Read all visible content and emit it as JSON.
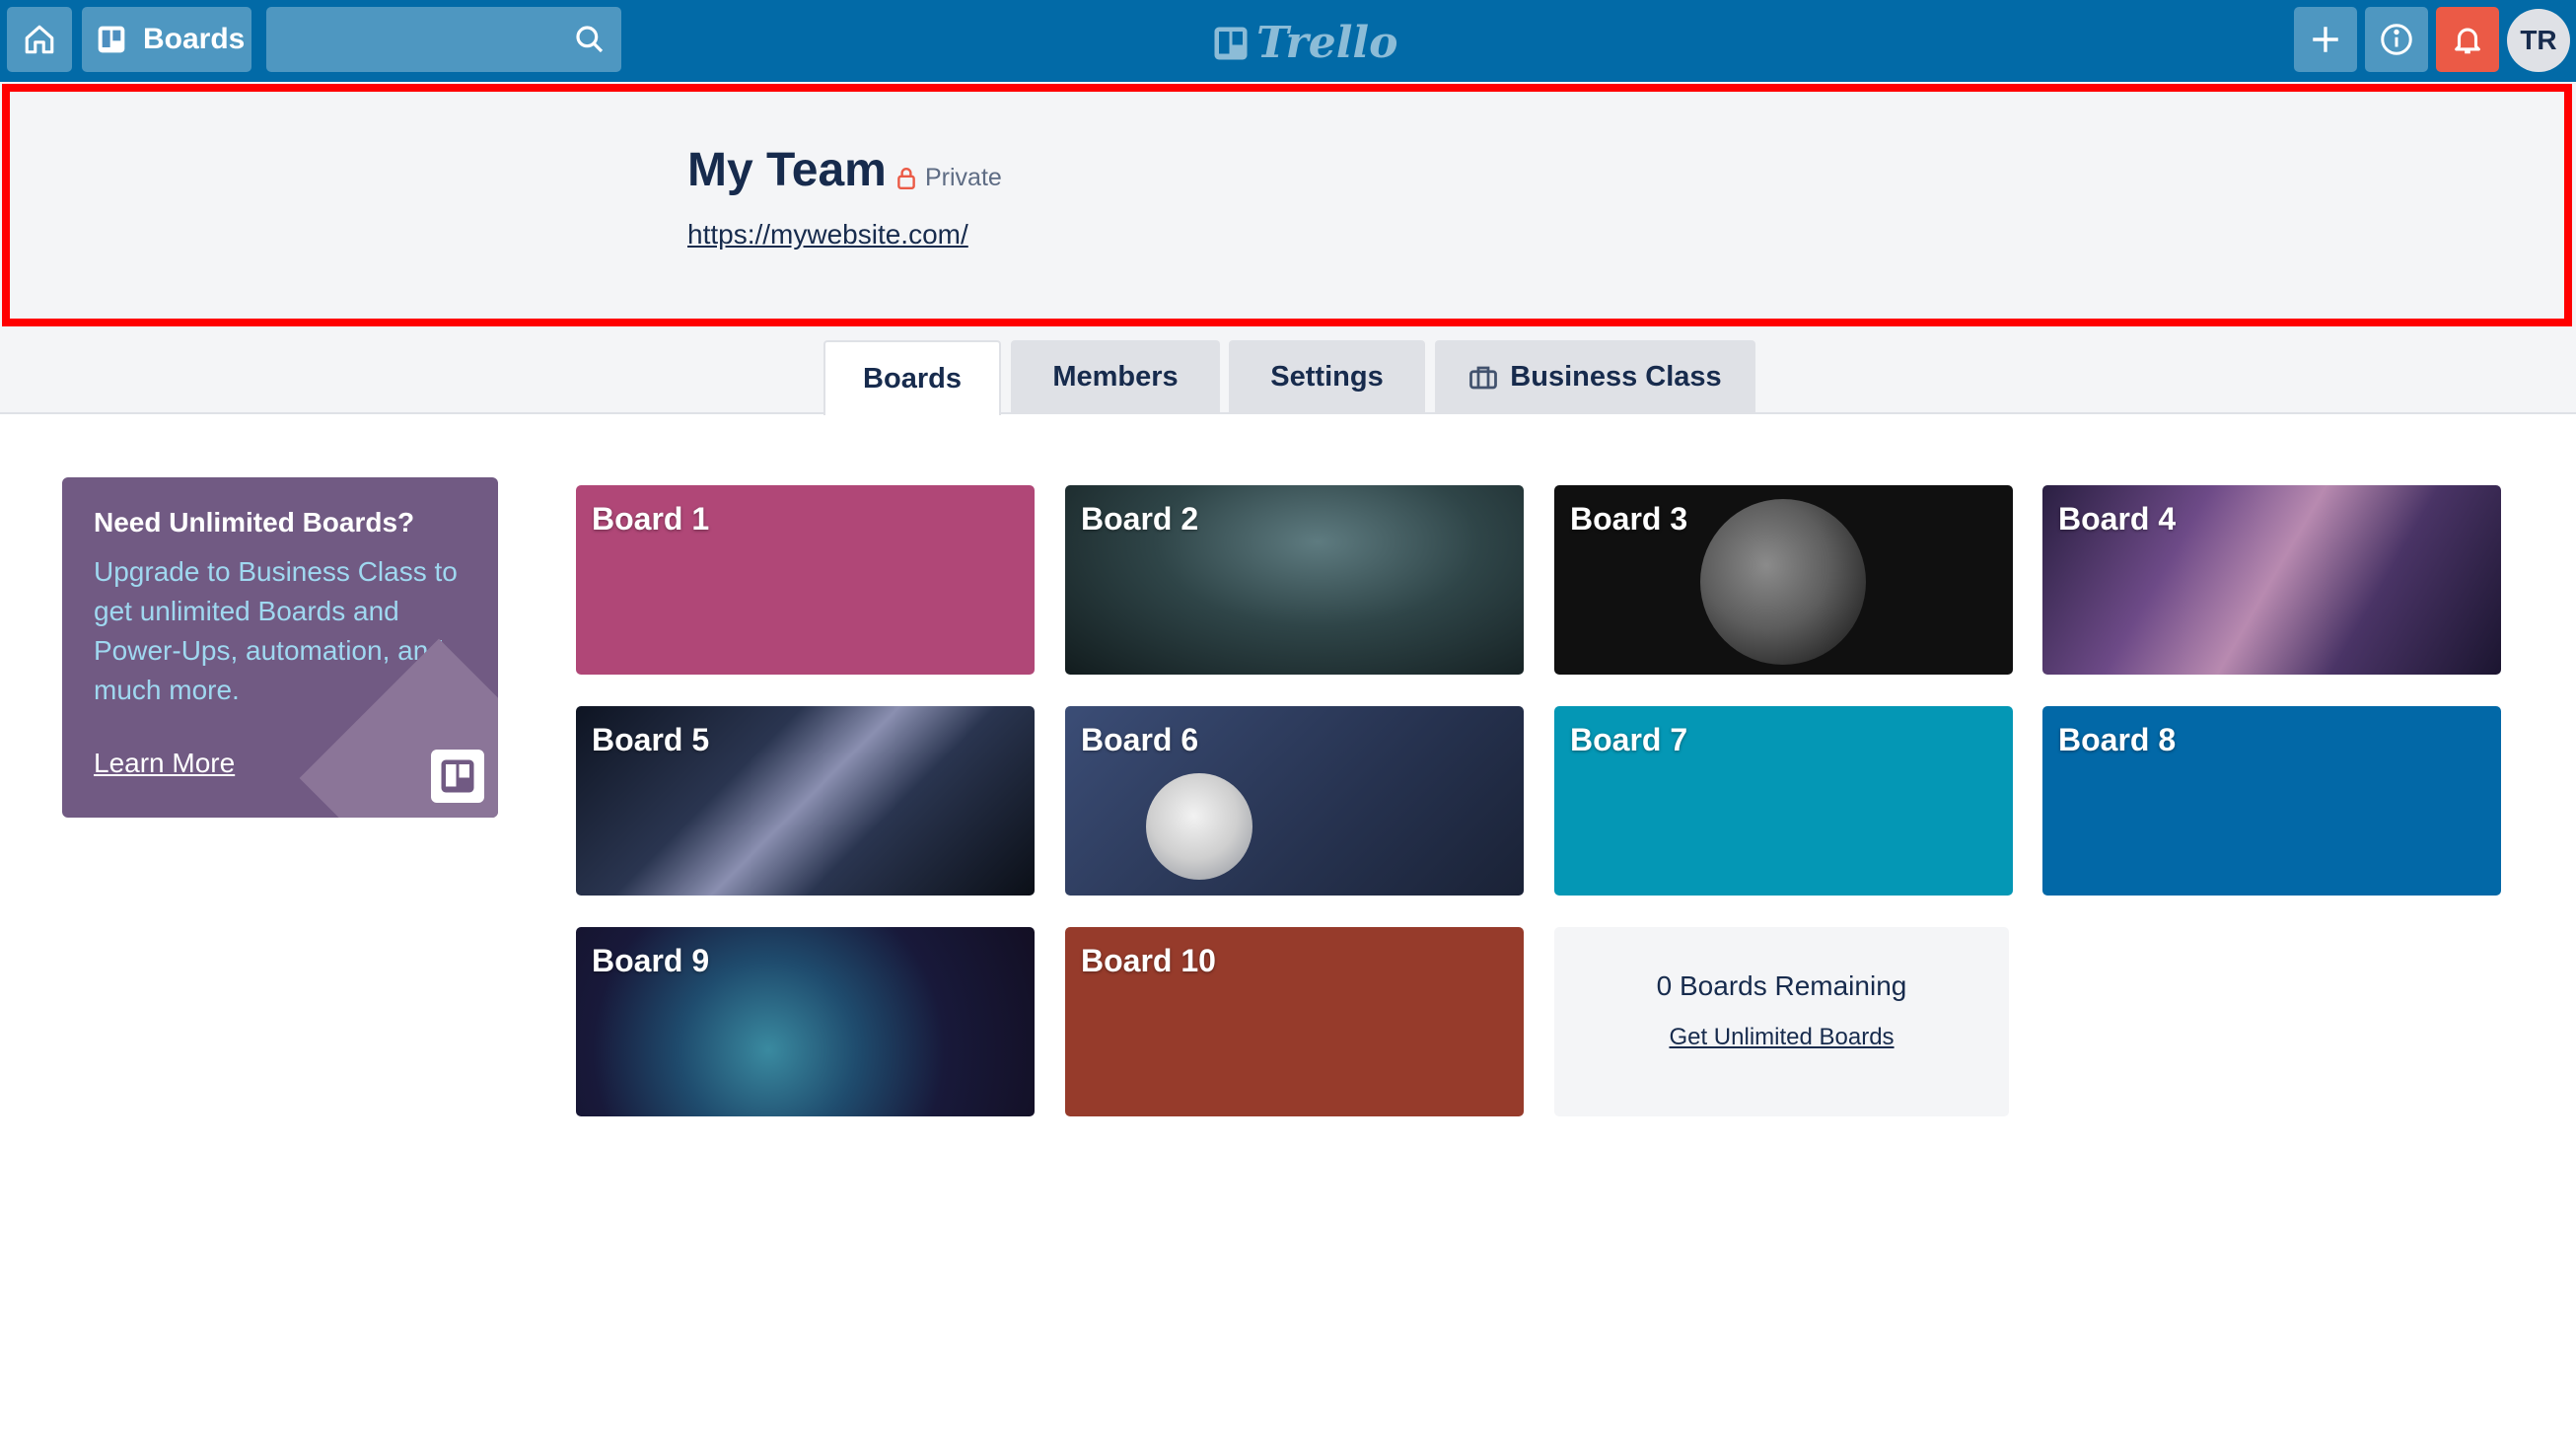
{
  "topbar": {
    "boards_label": "Boards",
    "logo_text": "Trello",
    "avatar_initials": "TR",
    "search_value": ""
  },
  "team": {
    "name": "My Team",
    "privacy": "Private",
    "url": "https://mywebsite.com/"
  },
  "tabs": [
    {
      "label": "Boards",
      "active": true
    },
    {
      "label": "Members",
      "active": false
    },
    {
      "label": "Settings",
      "active": false
    },
    {
      "label": "Business Class",
      "active": false,
      "icon": "briefcase-icon"
    }
  ],
  "promo": {
    "title": "Need Unlimited Boards?",
    "text": "Upgrade to Business Class to get unlimited Boards and Power-Ups, automation, and much more.",
    "link": "Learn More"
  },
  "boards": [
    {
      "name": "Board 1",
      "background": "#b04777"
    },
    {
      "name": "Board 2",
      "background": "photo-night-sky"
    },
    {
      "name": "Board 3",
      "background": "photo-moon"
    },
    {
      "name": "Board 4",
      "background": "photo-galaxy"
    },
    {
      "name": "Board 5",
      "background": "photo-milky-way"
    },
    {
      "name": "Board 6",
      "background": "photo-moon-blue"
    },
    {
      "name": "Board 7",
      "background": "#0497b5"
    },
    {
      "name": "Board 8",
      "background": "#0268a7"
    },
    {
      "name": "Board 9",
      "background": "photo-nebula"
    },
    {
      "name": "Board 10",
      "background": "#963b2b"
    }
  ],
  "remaining": {
    "count_text": "0 Boards Remaining",
    "link": "Get Unlimited Boards"
  },
  "colors": {
    "topbar": "#026aa7",
    "notification": "#eb5a46",
    "highlight": "#ff0000",
    "promo": "#715a83",
    "promo_text": "#9fd8f0"
  }
}
